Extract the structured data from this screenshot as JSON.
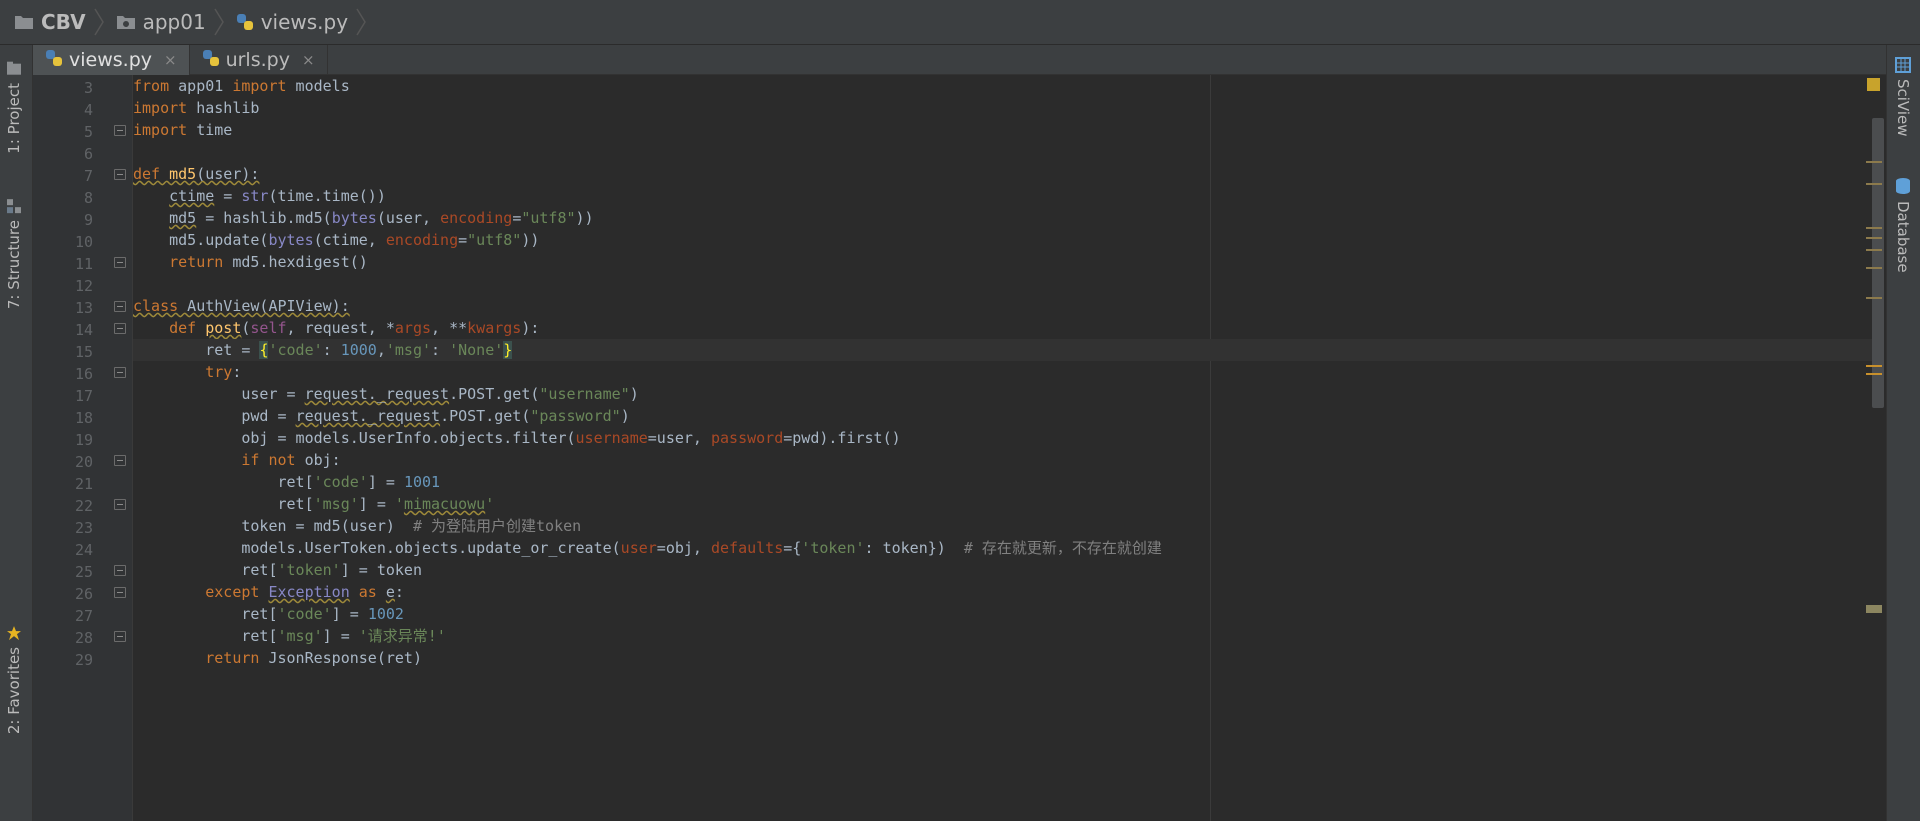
{
  "breadcrumb": {
    "project": "CBV",
    "folder": "app01",
    "file": "views.py"
  },
  "tabs": [
    {
      "label": "views.py",
      "active": true,
      "close": "×"
    },
    {
      "label": "urls.py",
      "active": false,
      "close": "×"
    }
  ],
  "left_tools": {
    "project": "1: Project",
    "structure": "7: Structure",
    "favorites": "2: Favorites"
  },
  "right_tools": {
    "sciview": "SciView",
    "database": "Database"
  },
  "colors": {
    "keyword": "#cc7832",
    "string": "#6a8759",
    "number": "#6897bb",
    "function": "#ffc66d",
    "comment": "#808080",
    "param": "#aa4926"
  },
  "lines": [
    {
      "n": "3",
      "html": "<span class='kw'>from</span> app01 <span class='kw'>import</span> models"
    },
    {
      "n": "4",
      "html": "<span class='kw'>import</span> hashlib"
    },
    {
      "n": "5",
      "html": "<span class='kw'>import</span> time",
      "fold": true
    },
    {
      "n": "6",
      "html": ""
    },
    {
      "n": "7",
      "html": "<span class='kw u'>def</span><span class='u'> <span class='fn'>md5</span>(user):</span>",
      "fold": true
    },
    {
      "n": "8",
      "html": "    <span class='u'>ctime</span> = <span class='bi'>str</span>(time.time())"
    },
    {
      "n": "9",
      "html": "    <span class='u'>md5</span> = hashlib.md5(<span class='bi'>bytes</span>(user, <span class='param'>encoding</span>=<span class='str'>\"utf8\"</span>))"
    },
    {
      "n": "10",
      "html": "    md5.update(<span class='bi'>bytes</span>(ctime, <span class='param'>encoding</span>=<span class='str'>\"utf8\"</span>))"
    },
    {
      "n": "11",
      "html": "    <span class='kw'>return</span> md5.hexdigest()",
      "fold": true
    },
    {
      "n": "12",
      "html": ""
    },
    {
      "n": "13",
      "html": "<span class='kw u'>class</span><span class='u'> AuthView(APIView):</span>",
      "fold": true
    },
    {
      "n": "14",
      "html": "    <span class='kw'>def</span> <span class='fn u'>post</span>(<span class='self'>self</span>, request, *<span class='param'>args</span>, **<span class='param'>kwargs</span>):",
      "fold": true
    },
    {
      "n": "15",
      "html": "        ret = <span class='bracket'>{</span><span class='str'>'code'</span>: <span class='num'>1000</span>,<span class='str'>'msg'</span>: <span class='str'>'None'</span><span class='bracket'>}</span>",
      "current": true
    },
    {
      "n": "16",
      "html": "        <span class='kw'>try</span>:",
      "fold": true
    },
    {
      "n": "17",
      "html": "            user = <span class='u'>request._request</span>.POST.get(<span class='str'>\"username\"</span>)"
    },
    {
      "n": "18",
      "html": "            pwd = <span class='u'>request._request</span>.POST.get(<span class='str'>\"password\"</span>)"
    },
    {
      "n": "19",
      "html": "            obj = models.UserInfo.objects.filter(<span class='param'>username</span>=user, <span class='param'>password</span>=pwd).first()"
    },
    {
      "n": "20",
      "html": "            <span class='kw'>if not</span> obj:",
      "fold": true
    },
    {
      "n": "21",
      "html": "                ret[<span class='str'>'code'</span>] = <span class='num'>1001</span>"
    },
    {
      "n": "22",
      "html": "                ret[<span class='str'>'msg'</span>] = <span class='str'>'<span class=\"u\">mimacuowu</span>'</span>",
      "fold": true
    },
    {
      "n": "23",
      "html": "            token = md5(user)  <span class='cmt'># 为登陆用户创建token</span>"
    },
    {
      "n": "24",
      "html": "            models.UserToken.objects.update_or_create(<span class='param'>user</span>=obj, <span class='param'>defaults</span>={<span class='str'>'token'</span>: token})  <span class='cmt'># 存在就更新，不存在就创建</span>"
    },
    {
      "n": "25",
      "html": "            ret[<span class='str'>'token'</span>] = token",
      "fold": true
    },
    {
      "n": "26",
      "html": "        <span class='kw'>except</span> <span class='bi u'>Exception</span> <span class='kw'>as</span> <span class='u'>e</span>:",
      "fold": true
    },
    {
      "n": "27",
      "html": "            ret[<span class='str'>'code'</span>] = <span class='num'>1002</span>"
    },
    {
      "n": "28",
      "html": "            ret[<span class='str'>'msg'</span>] = <span class='str'>'请求异常!'</span>",
      "fold": true
    },
    {
      "n": "29",
      "html": "        <span class='kw'>return</span> JsonResponse(ret)"
    }
  ]
}
